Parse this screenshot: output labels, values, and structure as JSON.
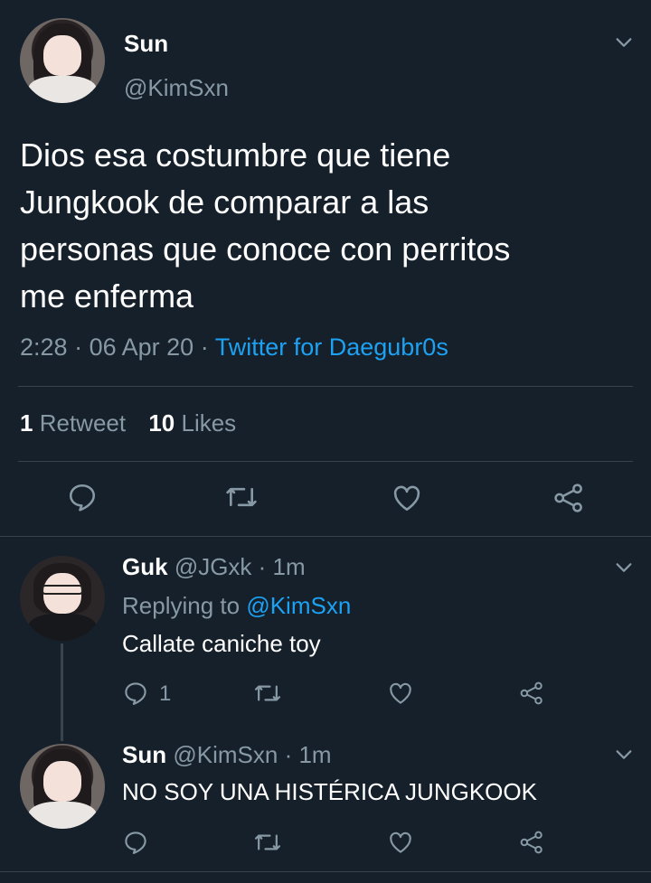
{
  "main_tweet": {
    "name": "Sun",
    "handle": "@KimSxn",
    "text_lines": [
      "Dios esa costumbre que tiene",
      "Jungkook de comparar a las",
      "personas que conoce con perritos",
      "me enferma"
    ],
    "time": "2:28",
    "separator": "·",
    "date": "06 Apr 20",
    "source": "Twitter for Daegubr0s",
    "retweets_count": "1",
    "retweets_label": "Retweet",
    "likes_count": "10",
    "likes_label": "Likes"
  },
  "replies": [
    {
      "name": "Guk",
      "handle": "@JGxk",
      "time": "· 1m",
      "replying_prefix": "Replying to",
      "replying_to": "@KimSxn",
      "text": "Callate caniche toy",
      "reply_count": "1"
    },
    {
      "name": "Sun",
      "handle": "@KimSxn",
      "time": "· 1m",
      "text": "NO SOY UNA HISTÉRICA JUNGKOOK"
    }
  ],
  "icons": {
    "reply": "reply-icon",
    "retweet": "retweet-icon",
    "like": "heart-icon",
    "share": "share-icon",
    "menu": "chevron-down-icon"
  },
  "colors": {
    "background": "#15202b",
    "accent": "#1da1f2",
    "muted": "#8899a6",
    "divider": "#38444d"
  }
}
